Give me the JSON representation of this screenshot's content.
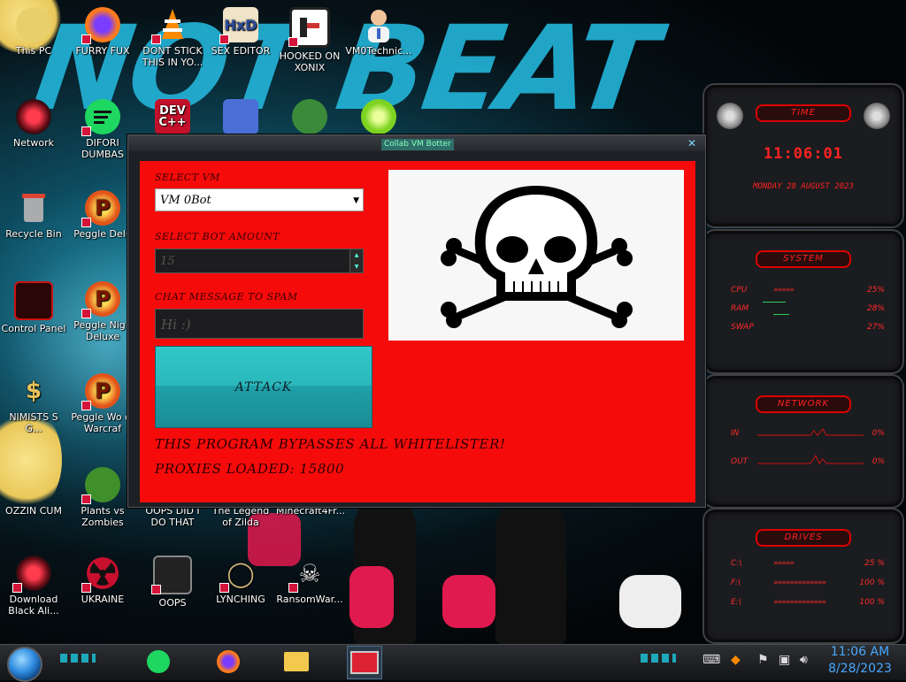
{
  "desktop": {
    "wallpaper_text": "NOT BEAT",
    "icons": [
      {
        "label": "This PC",
        "icon": "computer-icon"
      },
      {
        "label": "FURRY FUX",
        "icon": "firefox-icon"
      },
      {
        "label": "DONT STICK THIS IN YO...",
        "icon": "vlc-cone-icon"
      },
      {
        "label": "SEX EDITOR",
        "icon": "hxd-editor-icon"
      },
      {
        "label": "HOOKED ON XONIX",
        "icon": "xonix-game-icon"
      },
      {
        "label": "VM0Technic...",
        "icon": "doctor-icon"
      },
      {
        "label": "Network",
        "icon": "network-icon"
      },
      {
        "label": "DIFORI DUMBAS",
        "icon": "discord-like-icon"
      },
      {
        "label": "Recycle Bin",
        "icon": "recycle-bin-icon"
      },
      {
        "label": "Peggle Delu",
        "icon": "peggle-icon"
      },
      {
        "label": "Control Panel",
        "icon": "control-panel-icon"
      },
      {
        "label": "Peggle Nigh Deluxe",
        "icon": "peggle-icon"
      },
      {
        "label": "NIMISTS S G...",
        "icon": "money-bag-icon"
      },
      {
        "label": "Peggle Wo of Warcraf",
        "icon": "peggle-icon"
      },
      {
        "label": "OZZIN CUM",
        "icon": "character-icon"
      },
      {
        "label": "Plants vs Zombies",
        "icon": "plants-vs-zombies-icon"
      },
      {
        "label": "OOPS DID I DO THAT",
        "icon": "oops-icon"
      },
      {
        "label": "The Legend of Zilda",
        "icon": "zelda-icon"
      },
      {
        "label": "Minecraft4Fr...",
        "icon": "minecraft-icon"
      },
      {
        "label": "Download Black Ali...",
        "icon": "alien-icon"
      },
      {
        "label": "UKRAINE",
        "icon": "radiation-icon"
      },
      {
        "label": "OOPS",
        "icon": "monitor-icon"
      },
      {
        "label": "LYNCHING",
        "icon": "noose-icon"
      },
      {
        "label": "RansomWar...",
        "icon": "skull-icon"
      }
    ],
    "top_icons_row2": [
      "DEV C++",
      "card-icon",
      "santa-icon",
      "lime-icon"
    ]
  },
  "gadgets": {
    "time": {
      "title": "TIME",
      "clock": "11:06:01",
      "date": "MONDAY 28 AUGUST 2023"
    },
    "system": {
      "title": "SYSTEM",
      "rows": [
        {
          "label": "CPU",
          "value": "25%"
        },
        {
          "label": "RAM",
          "value": "28%"
        },
        {
          "label": "SWAP",
          "value": "27%"
        }
      ]
    },
    "network": {
      "title": "NETWORK",
      "rows": [
        {
          "label": "IN",
          "value": "0%"
        },
        {
          "label": "OUT",
          "value": "0%"
        }
      ]
    },
    "drives": {
      "title": "DRIVES",
      "rows": [
        {
          "label": "C:\\",
          "value": "25 %"
        },
        {
          "label": "F:\\",
          "value": "100 %"
        },
        {
          "label": "E:\\",
          "value": "100 %"
        }
      ]
    }
  },
  "app": {
    "title": "Collab VM Botter",
    "close_glyph": "✕",
    "select_vm_label": "SELECT VM",
    "select_vm_value": "VM 0Bot",
    "bot_amount_label": "SELECT BOT AMOUNT",
    "bot_amount_value": "15",
    "chat_label": "CHAT MESSAGE TO SPAM",
    "chat_value": "Hi :)",
    "attack_label": "ATTACK",
    "bypass_text": "THIS PROGRAM BYPASSES ALL WHITELISTER!",
    "proxies_text": "PROXIES LOADED: 15800"
  },
  "taskbar": {
    "apps": [
      "spotify-icon",
      "firefox-icon",
      "file-explorer-icon",
      "collab-vm-botter-icon"
    ],
    "tray_icons": [
      "keyboard-icon",
      "avast-icon",
      "flag-icon",
      "network-tray-icon",
      "volume-icon"
    ],
    "time": "11:06 AM",
    "date": "8/28/2023"
  }
}
